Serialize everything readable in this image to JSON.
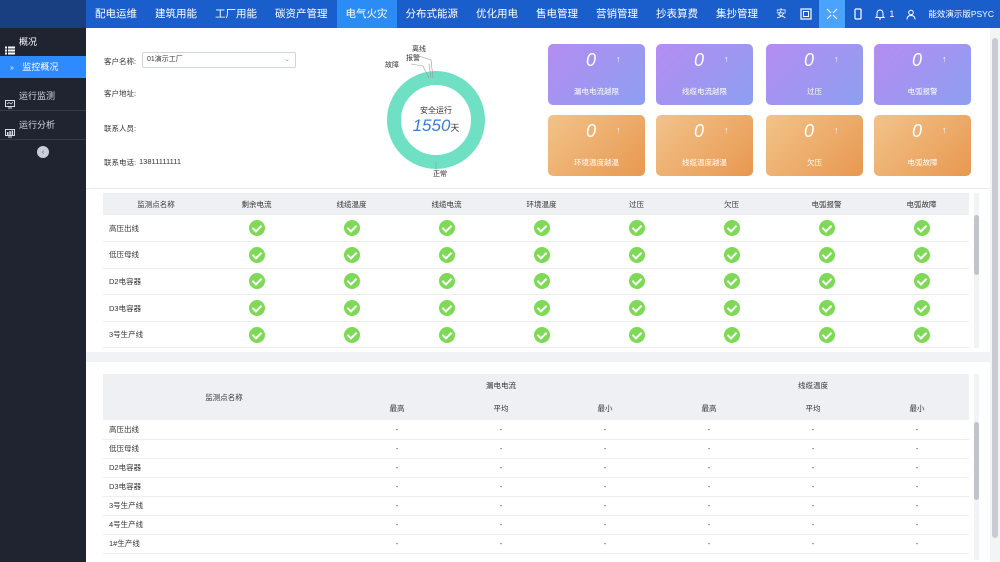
{
  "nav": {
    "items": [
      "配电运维",
      "建筑用能",
      "工厂用能",
      "碳资产管理",
      "电气火灾",
      "分布式能源",
      "优化用电",
      "售电管理",
      "营销管理",
      "抄表算费",
      "集抄管理",
      "安"
    ],
    "active_index": 4,
    "notification_count": "1",
    "user": "能效演示版PSYC"
  },
  "sidebar": {
    "section": "概况",
    "sub_item": "监控概况",
    "items": [
      "运行监测",
      "运行分析"
    ]
  },
  "customer": {
    "name_label": "客户名称:",
    "name_value": "01演示工厂",
    "address_label": "客户地址:",
    "contact_label": "联系人员:",
    "phone_label": "联系电话:",
    "phone_value": "13811111111"
  },
  "donut": {
    "title": "安全运行",
    "days": "1550",
    "unit": "天",
    "labels": {
      "offline": "离线",
      "alarm": "报警",
      "fault": "故障",
      "normal": "正常"
    },
    "normal_color": "#6fe0c4"
  },
  "cards": [
    {
      "value": "0",
      "label": "漏电电流越限",
      "color": "purple"
    },
    {
      "value": "0",
      "label": "线缆电流越限",
      "color": "purple"
    },
    {
      "value": "0",
      "label": "过压",
      "color": "purple"
    },
    {
      "value": "0",
      "label": "电弧报警",
      "color": "purple"
    },
    {
      "value": "0",
      "label": "环境温度越温",
      "color": "orange"
    },
    {
      "value": "0",
      "label": "线缆温度越温",
      "color": "orange"
    },
    {
      "value": "0",
      "label": "欠压",
      "color": "orange"
    },
    {
      "value": "0",
      "label": "电弧故障",
      "color": "orange"
    }
  ],
  "status_table": {
    "headers": [
      "监测点名称",
      "剩余电流",
      "线缆温度",
      "线缆电流",
      "环境温度",
      "过压",
      "欠压",
      "电弧报警",
      "电弧故障"
    ],
    "rows": [
      "高压出线",
      "低压母线",
      "D2电容器",
      "D3电容器",
      "3号生产线"
    ]
  },
  "stats_table": {
    "name_header": "监测点名称",
    "groups": [
      "漏电电流",
      "线缆温度"
    ],
    "sub_headers": [
      "最高",
      "平均",
      "最小",
      "最高",
      "平均",
      "最小"
    ],
    "rows": [
      "高压出线",
      "低压母线",
      "D2电容器",
      "D3电容器",
      "3号生产线",
      "4号生产线",
      "1#生产线"
    ],
    "empty_value": "-"
  }
}
